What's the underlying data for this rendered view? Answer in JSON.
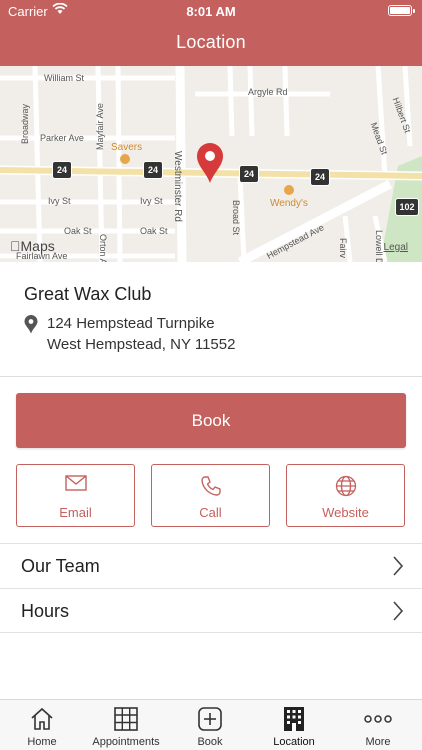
{
  "status_bar": {
    "carrier": "Carrier",
    "time": "8:01 AM"
  },
  "header": {
    "title": "Location"
  },
  "map": {
    "streets": [
      "William St",
      "Argyle Rd",
      "Parker Ave",
      "Ivy St",
      "Ivy St",
      "Oak St",
      "Oak St",
      "Fairlawn Ave",
      "Westminster Rd",
      "Broadway",
      "Mayfair Ave",
      "Broad St",
      "Hempstead Ave",
      "Mead St",
      "Hilbert St",
      "Orton Ave",
      "Fairv",
      "Lowell Dr"
    ],
    "pois": [
      "Savers",
      "Wendy's"
    ],
    "route_shields": [
      "24",
      "24",
      "24",
      "24",
      "102"
    ],
    "attribution": "Maps",
    "legal": "Legal"
  },
  "business": {
    "name": "Great Wax Club",
    "address_line1": "124 Hempstead Turnpike",
    "address_line2": "West Hempstead, NY 11552"
  },
  "actions": {
    "book_label": "Book",
    "email_label": "Email",
    "call_label": "Call",
    "website_label": "Website"
  },
  "rows": [
    {
      "label": "Our Team"
    },
    {
      "label": "Hours"
    }
  ],
  "tabs": [
    {
      "label": "Home",
      "icon": "home-icon"
    },
    {
      "label": "Appointments",
      "icon": "calendar-grid-icon"
    },
    {
      "label": "Book",
      "icon": "add-square-icon"
    },
    {
      "label": "Location",
      "icon": "building-icon"
    },
    {
      "label": "More",
      "icon": "more-dots-icon"
    }
  ],
  "colors": {
    "accent": "#c4605d",
    "map_pin": "#d63a3a",
    "shield": "#333333"
  }
}
